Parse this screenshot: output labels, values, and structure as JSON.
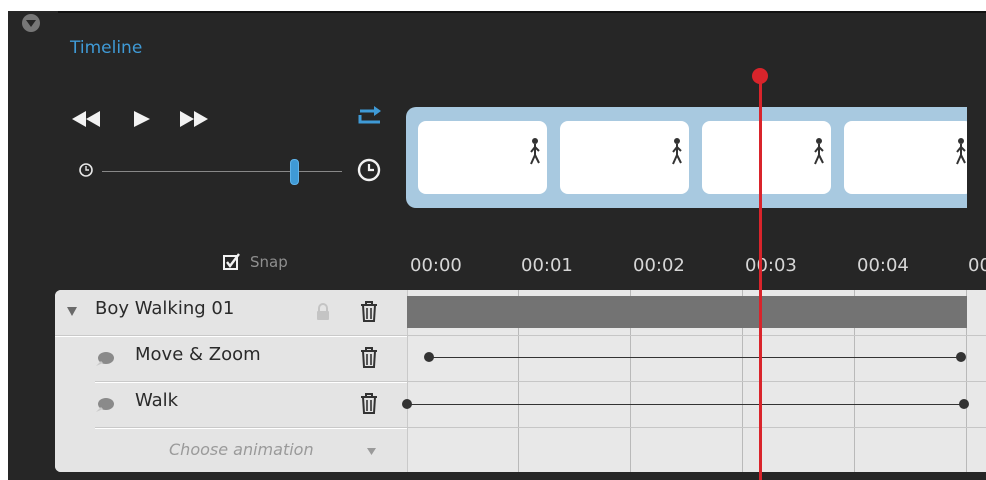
{
  "panel": {
    "title": "Timeline",
    "accent_color": "#3f9ad6",
    "playhead_color": "#d9242b"
  },
  "transport": {
    "rewind_icon": "rewind-icon",
    "play_icon": "play-icon",
    "fast_forward_icon": "fast-forward-icon",
    "loop_icon": "loop-icon"
  },
  "speed_slider": {
    "min_icon": "clock-small-icon",
    "max_icon": "clock-large-icon",
    "value_fraction": 0.8
  },
  "thumbnails": {
    "frame_count": 4
  },
  "snap": {
    "label": "Snap",
    "checked": true
  },
  "ruler": {
    "ticks": [
      "00:00",
      "00:01",
      "00:02",
      "00:03",
      "00:04",
      "00"
    ]
  },
  "tracks": {
    "object": {
      "name": "Boy Walking 01"
    },
    "animations": [
      {
        "name": "Move & Zoom"
      },
      {
        "name": "Walk"
      }
    ],
    "choose_animation": "Choose animation"
  }
}
